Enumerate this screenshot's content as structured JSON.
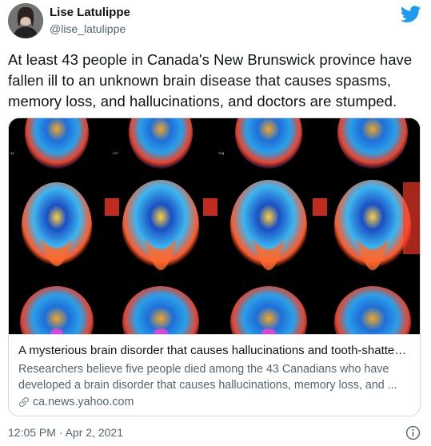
{
  "author": {
    "name": "Lise Latulippe",
    "handle": "@lise_latulippe"
  },
  "tweet": {
    "text": "At least 43 people in Canada's New Brunswick province have fallen ill to an unknown brain disease that causes spasms, memory loss, and hallucinations, and doctors are stumped.",
    "timestamp": "12:05 PM · Apr 2, 2021"
  },
  "card": {
    "title": "A mysterious brain disorder that causes hallucinations and tooth-shattering…",
    "description": "Researchers believe five people died among the 43 Canadians who have developed a brain disorder that causes hallucinations, memory loss, and ...",
    "domain": "ca.news.yahoo.com",
    "image_scan_labels": [
      "ax",
      "cor",
      "sag"
    ]
  },
  "icons": {
    "twitter": "twitter-bird-icon",
    "link": "link-icon",
    "info": "info-icon"
  },
  "colors": {
    "twitter_blue": "#1d9bf0",
    "text_primary": "#0f1419",
    "text_secondary": "#536471",
    "border": "#cfd9de"
  }
}
